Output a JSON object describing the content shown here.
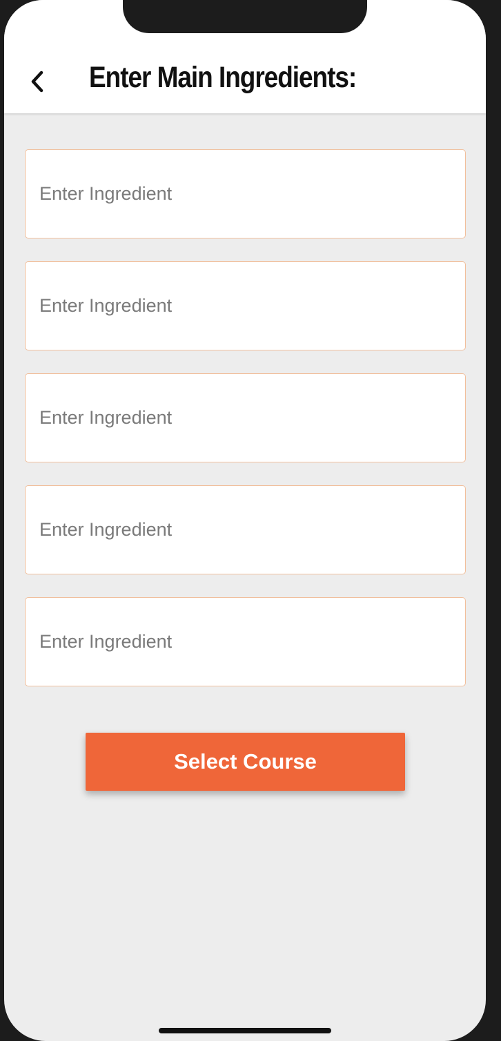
{
  "header": {
    "title": "Enter Main Ingredients:",
    "back_icon": "chevron-left-icon"
  },
  "ingredients": [
    {
      "value": "",
      "placeholder": "Enter Ingredient"
    },
    {
      "value": "",
      "placeholder": "Enter Ingredient"
    },
    {
      "value": "",
      "placeholder": "Enter Ingredient"
    },
    {
      "value": "",
      "placeholder": "Enter Ingredient"
    },
    {
      "value": "",
      "placeholder": "Enter Ingredient"
    }
  ],
  "actions": {
    "select_course_label": "Select Course"
  },
  "colors": {
    "accent": "#ef6639",
    "field_border": "#f1bf9c",
    "background": "#ededed"
  }
}
